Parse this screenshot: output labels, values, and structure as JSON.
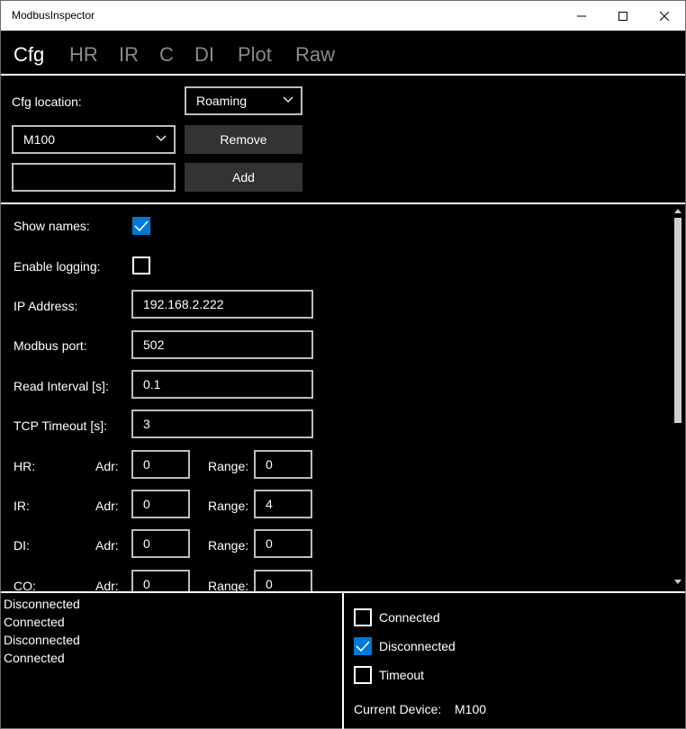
{
  "window": {
    "title": "ModbusInspector"
  },
  "tabs": [
    {
      "label": "Cfg"
    },
    {
      "label": "HR"
    },
    {
      "label": "IR"
    },
    {
      "label": "C"
    },
    {
      "label": "DI"
    },
    {
      "label": "Plot"
    },
    {
      "label": "Raw"
    }
  ],
  "cfg": {
    "location_label": "Cfg location:",
    "location_value": "Roaming",
    "device_value": "M100",
    "remove_label": "Remove",
    "add_label": "Add",
    "new_name_value": ""
  },
  "settings": {
    "show_names_label": "Show names:",
    "show_names_checked": true,
    "enable_logging_label": "Enable logging:",
    "enable_logging_checked": false,
    "ip_label": "IP Address:",
    "ip_value": "192.168.2.222",
    "port_label": "Modbus port:",
    "port_value": "502",
    "interval_label": "Read Interval [s]:",
    "interval_value": "0.1",
    "timeout_label": "TCP Timeout [s]:",
    "timeout_value": "3",
    "adr_label": "Adr:",
    "range_label": "Range:",
    "registers": [
      {
        "name": "HR:",
        "adr": "0",
        "range": "0"
      },
      {
        "name": "IR:",
        "adr": "0",
        "range": "4"
      },
      {
        "name": "DI:",
        "adr": "0",
        "range": "0"
      },
      {
        "name": "CO:",
        "adr": "0",
        "range": "0"
      }
    ]
  },
  "log": [
    "Disconnected",
    "Connected",
    "Disconnected",
    "Connected"
  ],
  "status": {
    "connected_label": "Connected",
    "connected_checked": false,
    "disconnected_label": "Disconnected",
    "disconnected_checked": true,
    "timeout_label": "Timeout",
    "timeout_checked": false,
    "current_device_label": "Current Device:",
    "current_device_value": "M100"
  },
  "colors": {
    "accent": "#0078d7",
    "background": "#000000",
    "button": "#333333"
  }
}
